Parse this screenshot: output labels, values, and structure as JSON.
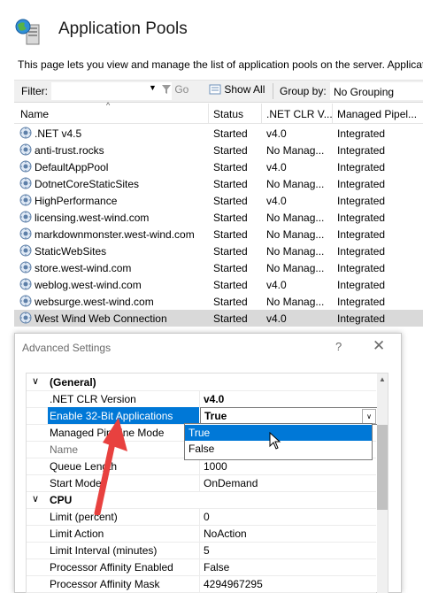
{
  "header": {
    "title": "Application Pools",
    "description": "This page lets you view and manage the list of application pools on the server. Applicati",
    "icon": "iis-server-globe-icon"
  },
  "toolbar": {
    "filter_label": "Filter:",
    "filter_value": "",
    "go_label": "Go",
    "show_all_label": "Show All",
    "group_by_label": "Group by:",
    "group_by_value": "No Grouping"
  },
  "grid": {
    "columns": [
      "Name",
      "Status",
      ".NET CLR V...",
      "Managed Pipel..."
    ],
    "rows": [
      {
        "name": ".NET v4.5",
        "status": "Started",
        "clr": "v4.0",
        "pipeline": "Integrated"
      },
      {
        "name": "anti-trust.rocks",
        "status": "Started",
        "clr": "No Manag...",
        "pipeline": "Integrated"
      },
      {
        "name": "DefaultAppPool",
        "status": "Started",
        "clr": "v4.0",
        "pipeline": "Integrated"
      },
      {
        "name": "DotnetCoreStaticSites",
        "status": "Started",
        "clr": "No Manag...",
        "pipeline": "Integrated"
      },
      {
        "name": "HighPerformance",
        "status": "Started",
        "clr": "v4.0",
        "pipeline": "Integrated"
      },
      {
        "name": "licensing.west-wind.com",
        "status": "Started",
        "clr": "No Manag...",
        "pipeline": "Integrated"
      },
      {
        "name": "markdownmonster.west-wind.com",
        "status": "Started",
        "clr": "No Manag...",
        "pipeline": "Integrated"
      },
      {
        "name": "StaticWebSites",
        "status": "Started",
        "clr": "No Manag...",
        "pipeline": "Integrated"
      },
      {
        "name": "store.west-wind.com",
        "status": "Started",
        "clr": "No Manag...",
        "pipeline": "Integrated"
      },
      {
        "name": "weblog.west-wind.com",
        "status": "Started",
        "clr": "v4.0",
        "pipeline": "Integrated"
      },
      {
        "name": "websurge.west-wind.com",
        "status": "Started",
        "clr": "No Manag...",
        "pipeline": "Integrated"
      },
      {
        "name": "West Wind Web Connection",
        "status": "Started",
        "clr": "v4.0",
        "pipeline": "Integrated"
      }
    ]
  },
  "dialog": {
    "title": "Advanced Settings",
    "help": "?",
    "close": "✕",
    "categories": [
      {
        "label": "(General)"
      },
      {
        "label": "CPU"
      }
    ],
    "properties": [
      {
        "name": ".NET CLR Version",
        "value": "v4.0"
      },
      {
        "name": "Enable 32-Bit Applications",
        "value": "True"
      },
      {
        "name": "Managed Pipeline Mode",
        "value": ""
      },
      {
        "name": "Name",
        "value": ""
      },
      {
        "name": "Queue Length",
        "value": "1000"
      },
      {
        "name": "Start Mode",
        "value": "OnDemand"
      },
      {
        "name": "Limit (percent)",
        "value": "0"
      },
      {
        "name": "Limit Action",
        "value": "NoAction"
      },
      {
        "name": "Limit Interval (minutes)",
        "value": "5"
      },
      {
        "name": "Processor Affinity Enabled",
        "value": "False"
      },
      {
        "name": "Processor Affinity Mask",
        "value": "4294967295"
      }
    ],
    "dropdown_options": [
      "True",
      "False"
    ]
  },
  "colors": {
    "selection": "#0078d7",
    "annotation_arrow": "#e8413f"
  }
}
